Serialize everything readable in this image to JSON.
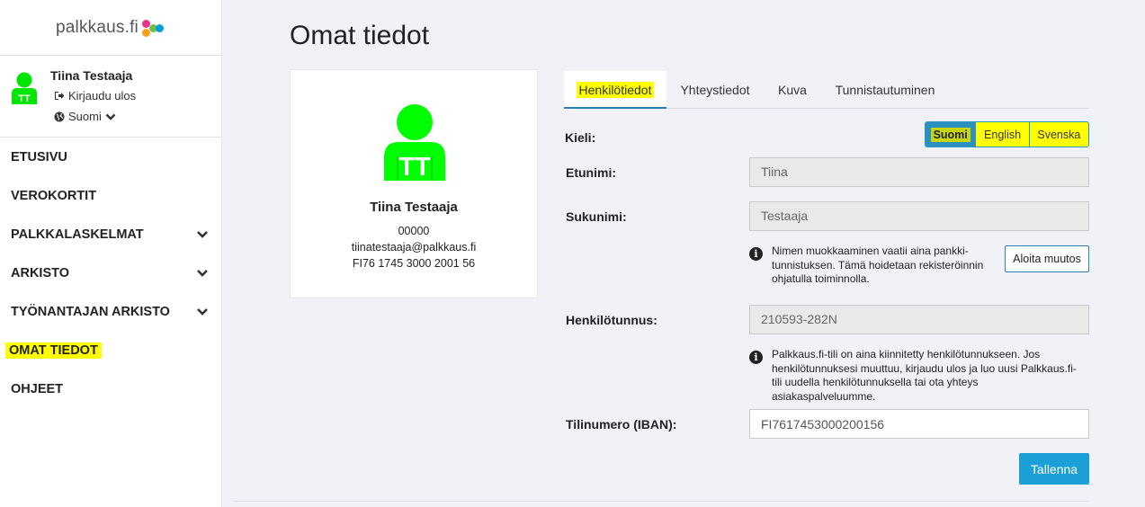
{
  "brand": {
    "logo_text": "palkkaus.fi"
  },
  "user": {
    "name": "Tiina Testaaja",
    "logout_label": "Kirjaudu ulos",
    "language_label": "Suomi",
    "initials": "TT",
    "avatar_color": "#00ff00"
  },
  "nav": {
    "items": [
      {
        "label": "ETUSIVU"
      },
      {
        "label": "VEROKORTIT"
      },
      {
        "label": "PALKKALASKELMAT"
      },
      {
        "label": "ARKISTO"
      },
      {
        "label": "TYÖNANTAJAN ARKISTO"
      },
      {
        "label": "OMAT TIEDOT"
      },
      {
        "label": "OHJEET"
      }
    ]
  },
  "page": {
    "title": "Omat tiedot"
  },
  "card": {
    "name": "Tiina Testaaja",
    "number": "00000",
    "email": "tiinatestaaja@palkkaus.fi",
    "iban_display": "FI76 1745 3000 2001 56"
  },
  "tabs": [
    {
      "label": "Henkilötiedot"
    },
    {
      "label": "Yhteystiedot"
    },
    {
      "label": "Kuva"
    },
    {
      "label": "Tunnistautuminen"
    }
  ],
  "form": {
    "language_label": "Kieli:",
    "languages": [
      "Suomi",
      "English",
      "Svenska"
    ],
    "firstname_label": "Etunimi:",
    "firstname_value": "Tiina",
    "lastname_label": "Sukunimi:",
    "lastname_value": "Testaaja",
    "name_info": "Nimen muokkaaminen vaatii aina pankki-tunnistuksen. Tämä hoidetaan rekisteröinnin ohjatulla toiminnolla.",
    "change_button": "Aloita muutos",
    "ssn_label": "Henkilötunnus:",
    "ssn_value": "210593-282N",
    "ssn_info": "Palkkaus.fi-tili on aina kiinnitetty henkilötunnukseen. Jos henkilötunnuksesi muuttuu, kirjaudu ulos ja luo uusi Palkkaus.fi-tili uudella henkilötunnuksella tai ota yhteys asiakaspalveluumme.",
    "iban_label": "Tilinumero (IBAN):",
    "iban_value": "FI7617453000200156",
    "save_button": "Tallenna"
  },
  "colors": {
    "accent": "#1aa0d6",
    "highlight": "#ffff00"
  }
}
